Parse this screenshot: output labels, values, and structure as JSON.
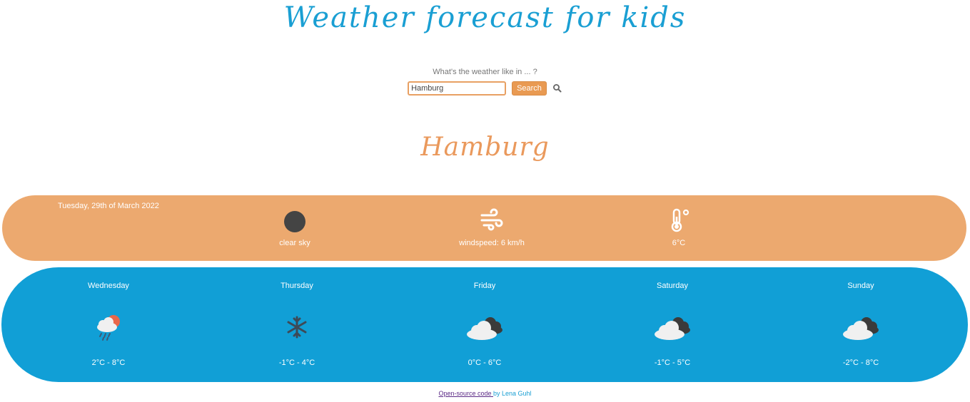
{
  "header": {
    "title": "Weather forecast for kids"
  },
  "search": {
    "prompt": "What's the weather like in ... ?",
    "value": "Hamburg",
    "button_label": "Search",
    "icon": "search-icon"
  },
  "city": {
    "name": "Hamburg"
  },
  "today": {
    "date": "Tuesday, 29th of March 2022",
    "condition": {
      "label": "clear sky",
      "icon": "clear-night-icon"
    },
    "wind": {
      "label": "windspeed: 6 km/h",
      "icon": "wind-icon"
    },
    "temperature": {
      "label": "6°C",
      "icon": "thermometer-icon"
    }
  },
  "forecast": {
    "days": [
      {
        "name": "Wednesday",
        "range": "2°C - 8°C",
        "icon": "sun-rain-cloud-icon"
      },
      {
        "name": "Thursday",
        "range": "-1°C - 4°C",
        "icon": "snowflake-icon"
      },
      {
        "name": "Friday",
        "range": "0°C - 6°C",
        "icon": "clouds-icon"
      },
      {
        "name": "Saturday",
        "range": "-1°C - 5°C",
        "icon": "clouds-icon"
      },
      {
        "name": "Sunday",
        "range": "-2°C - 8°C",
        "icon": "clouds-icon"
      }
    ]
  },
  "footer": {
    "link_text": "Open-source code ",
    "suffix": "by Lena Guhl"
  },
  "colors": {
    "title": "#1a9fd3",
    "city": "#ea995c",
    "today_band": "#eca96f",
    "forecast_band": "#119fd6",
    "button": "#e99a52"
  }
}
